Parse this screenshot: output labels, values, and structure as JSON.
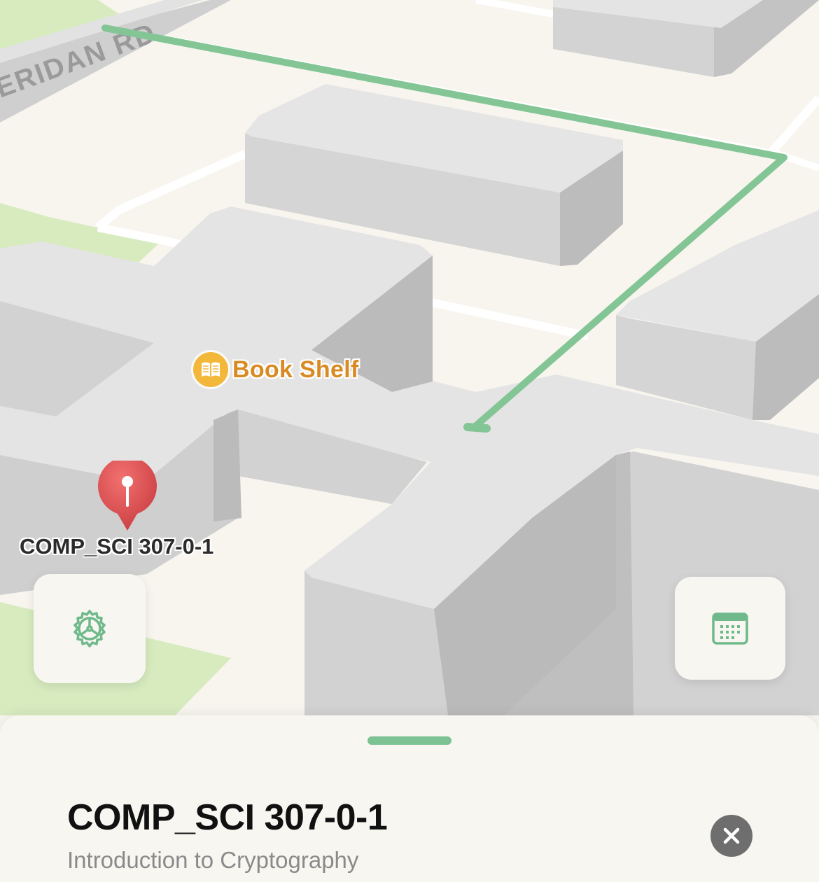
{
  "map": {
    "road_label": "ERIDAN RD",
    "poi": {
      "label": "Book Shelf",
      "icon": "open-book-icon",
      "color": "#d98a22"
    },
    "pin": {
      "label": "COMP_SCI 307-0-1",
      "icon": "map-pin-icon",
      "color": "#d9474a"
    },
    "route_color": "#84c596"
  },
  "controls": {
    "settings_icon": "gear-icon",
    "calendar_icon": "calendar-icon",
    "accent": "#6fb98a"
  },
  "sheet": {
    "title": "COMP_SCI 307-0-1",
    "subtitle": "Introduction to Cryptography",
    "close_icon": "close-icon"
  }
}
